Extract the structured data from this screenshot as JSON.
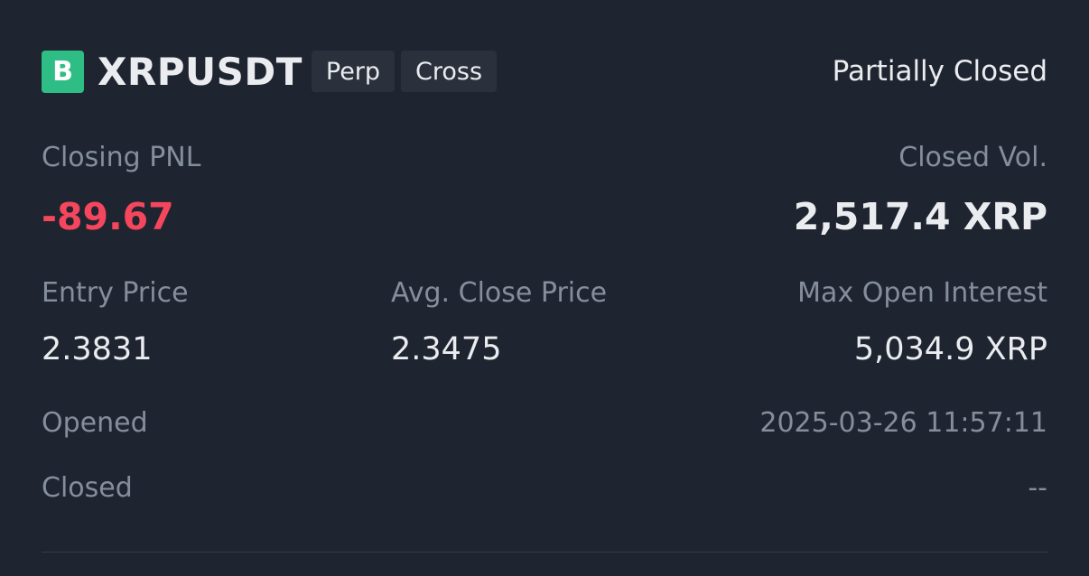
{
  "position": {
    "side_badge": "B",
    "symbol": "XRPUSDT",
    "tags": [
      "Perp",
      "Cross"
    ],
    "status": "Partially Closed"
  },
  "summary": {
    "closing_pnl_label": "Closing PNL",
    "closing_pnl_value": "-89.67",
    "closed_vol_label": "Closed Vol.",
    "closed_vol_value": "2,517.4 XRP"
  },
  "prices": {
    "entry_price_label": "Entry Price",
    "entry_price_value": "2.3831",
    "avg_close_price_label": "Avg. Close Price",
    "avg_close_price_value": "2.3475",
    "max_open_interest_label": "Max Open Interest",
    "max_open_interest_value": "5,034.9 XRP"
  },
  "times": {
    "opened_label": "Opened",
    "opened_value": "2025-03-26 11:57:11",
    "closed_label": "Closed",
    "closed_value": "--"
  },
  "colors": {
    "background": "#1f2530",
    "buy_green": "#2ebd85",
    "loss_red": "#f6465d",
    "muted_text": "#848e9c",
    "primary_text": "#eaecef"
  }
}
